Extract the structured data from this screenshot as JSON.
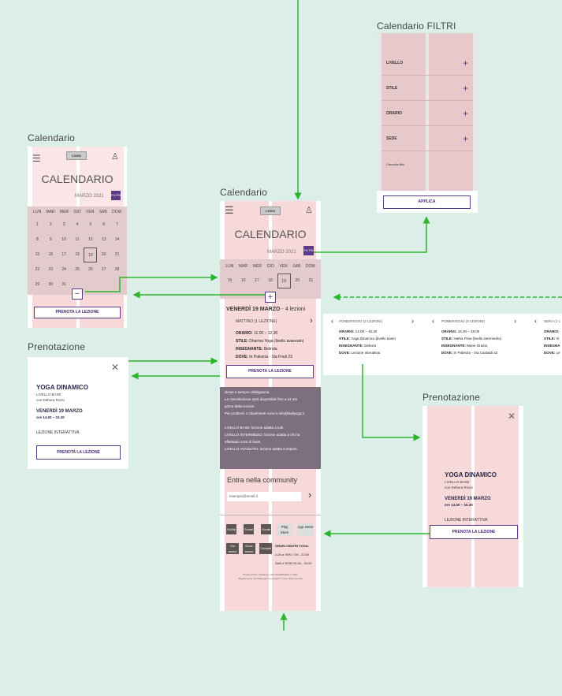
{
  "titles": {
    "cal_left": "Calendario",
    "cal_mid": "Calendario",
    "filters": "Calendario FILTRI",
    "pren_left": "Prenotazione",
    "pren_right": "Prenotazione"
  },
  "logo": "LOGO",
  "cal": {
    "title": "CALENDARIO",
    "month": "MARZO 2021",
    "filter_btn": "FILTRI",
    "days": [
      "LUN",
      "MAR",
      "MER",
      "GIO",
      "VEN",
      "SAB",
      "DOM"
    ],
    "dates": [
      "1",
      "2",
      "3",
      "4",
      "5",
      "6",
      "7",
      "8",
      "9",
      "10",
      "11",
      "12",
      "13",
      "14",
      "15",
      "16",
      "17",
      "18",
      "19",
      "20",
      "21",
      "22",
      "23",
      "24",
      "25",
      "26",
      "27",
      "28",
      "29",
      "30",
      "31"
    ],
    "week": [
      "15",
      "16",
      "17",
      "18",
      "19",
      "20",
      "21"
    ],
    "collapse": "−",
    "expand": "+",
    "book": "PRENOTA LA LEZIONE"
  },
  "day": {
    "heading": "VENERDÌ 19 MARZO",
    "count": "- 4 lezioni",
    "slot": "MATTINO (1 LEZIONE)",
    "orario_l": "ORARIO:",
    "orario": "11.00 – 12.30",
    "stile_l": "STILE:",
    "stile": "Dharma Yoga (livello avanzato)",
    "ins_l": "INSEGNANTE:",
    "ins": "Belinda",
    "dove_l": "DOVE:",
    "dove": "In Palestra - Via Friuli 23",
    "book": "PRENOTA LA LEZIONE"
  },
  "info": {
    "l1": "sksae e sempre obbligatoria.",
    "l2": "La cancellazione sarà disponibile fino a 24 ore",
    "l3": "prima della lezione.",
    "l4": "Per problemi o chiarimenti scrivi a info@ballyoga.it",
    "l5": "LIVELLO BASE: lezione adatta a tutti.",
    "l6": "LIVELLO INTERMEDIO: lezione adatta a chi ha",
    "l7": "effettuato corsi di base.",
    "l8": "LIVELLO AVANZATO: lezione adatta a esperti."
  },
  "community": {
    "title": "Entra nella community",
    "placeholder": "esempio@email.it",
    "arrow": "›"
  },
  "footer": {
    "social": [
      "Social",
      "Social",
      "Social"
    ],
    "play": "Play Store",
    "app": "App Store",
    "chi": "Chi siamo",
    "dove": "Dove siamo",
    "cont": "Contatti",
    "orari_t": "ORARI CENTRI YOGA:",
    "orari1": "LUN a VEN   7.00 - 22.00",
    "orari2": "SAB e DOM  10.00 - 20.00",
    "legal1": "Privacy Policy | Settings | VAT 0123456789 | © 2021",
    "legal2": "Regolamento ass.Ballyoga.it  Copyright © Tutti i diritti riservati"
  },
  "filters": {
    "items": [
      "LIVELLO",
      "STILE",
      "ORARIO",
      "SEDE"
    ],
    "clear": "Cancella filtri",
    "apply": "APPLICA",
    "plus": "+"
  },
  "slots": [
    {
      "slot": "POMERIGGIO (2 LEZIONI)",
      "orario": "14.00 – 15.30",
      "stile": "Yoga Dinamico (livello base)",
      "ins": "Debora",
      "dove": "Lezione Interattiva"
    },
    {
      "slot": "POMERIGGIO (2 LEZIONI)",
      "orario": "16.30 – 18.00",
      "stile": "Hatha Flow (livello intermedio)",
      "ins": "Marie Grazia",
      "dove": "In Palestra - Via Castaldi 42"
    },
    {
      "slot": "SERA (1 L",
      "orario": "",
      "stile": "Vi",
      "ins": "",
      "dove": "Le"
    }
  ],
  "labels": {
    "orario": "ORARIO:",
    "stile": "STILE:",
    "ins": "INSEGNANTE:",
    "insg": "INSEGNA",
    "dove": "DOVE:"
  },
  "pren": {
    "close": "✕",
    "title": "YOGA DINAMICO",
    "level": "LIVELLO BASE",
    "teacher": "con Debora Rossi",
    "date": "VENERDÌ 19 MARZO",
    "time": "ore 14.00 – 15.30",
    "mode": "LEZIONE INTERATTIVA",
    "book": "PRENOTA LA LEZIONE"
  },
  "nav": {
    "prev": "‹",
    "next": "›"
  },
  "colors": {
    "background": "#dbeee8",
    "accent": "#5b3b86",
    "arrow": "#2bb52b",
    "stripe": "#f8d9da"
  }
}
